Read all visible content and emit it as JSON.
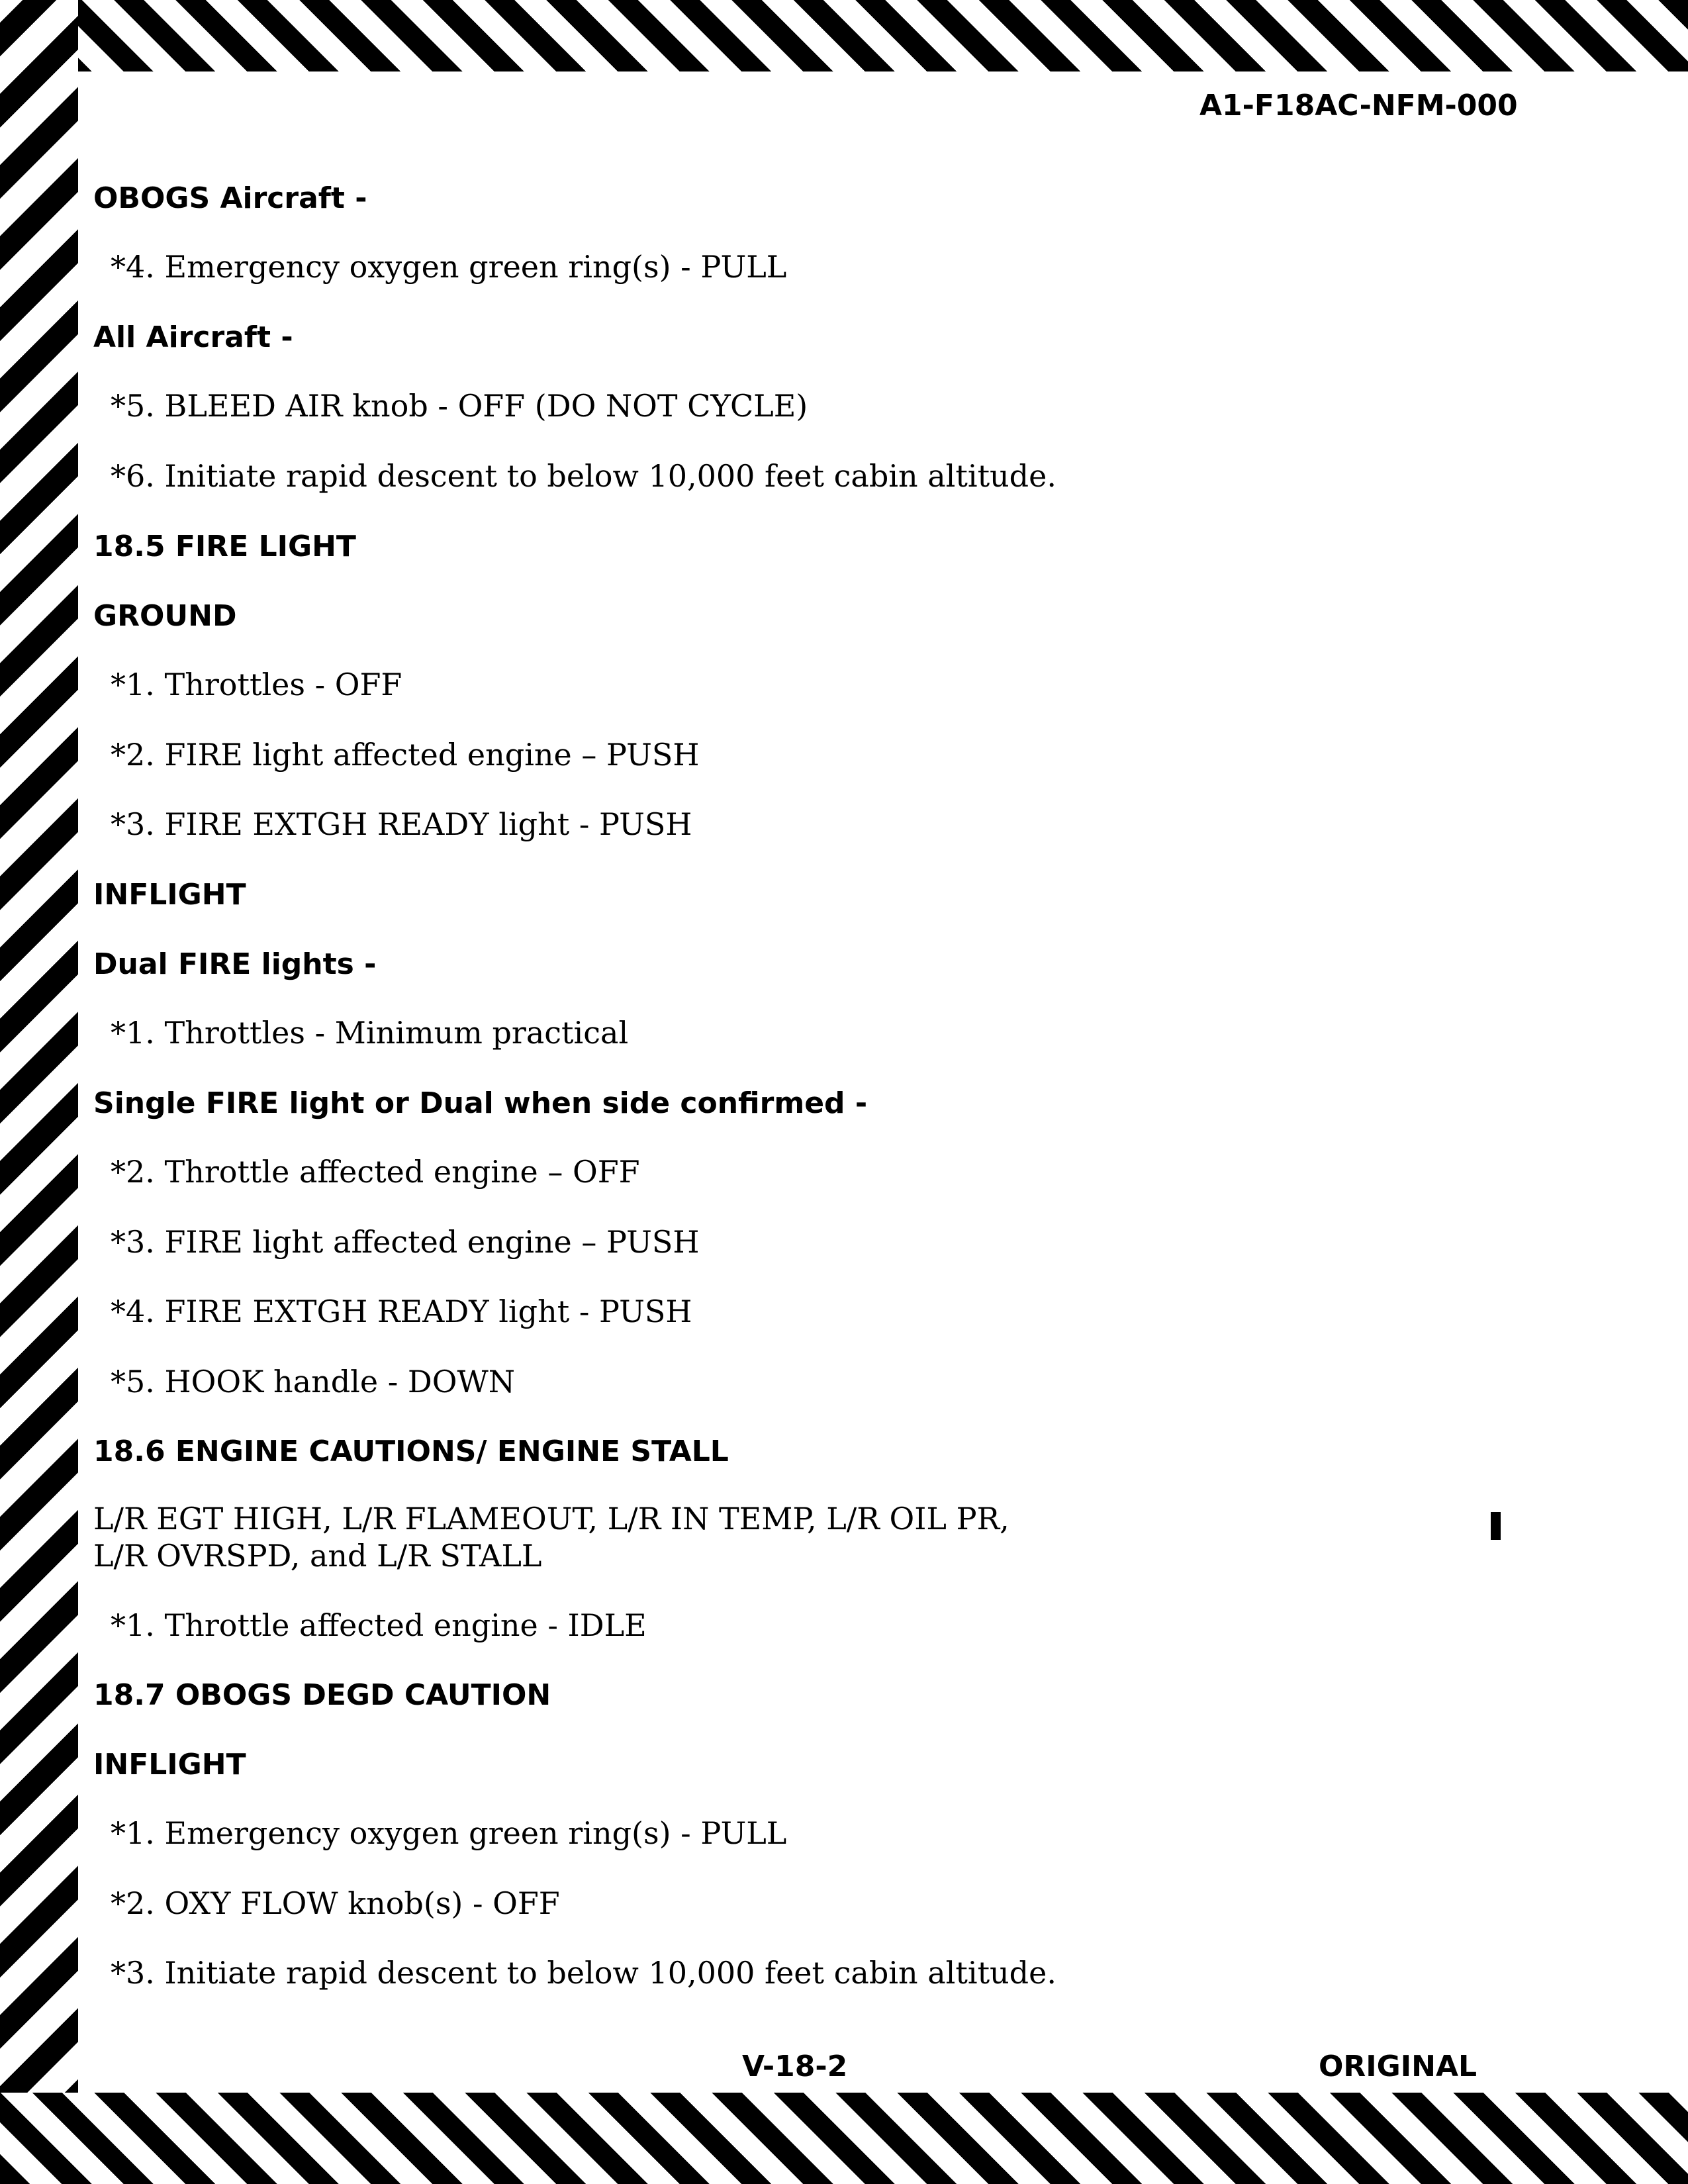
{
  "header": {
    "doc_id": "A1-F18AC-NFM-000"
  },
  "sections": [
    {
      "type": "heading",
      "text": "OBOGS Aircraft -"
    },
    {
      "type": "step",
      "text": "*4.  Emergency oxygen green ring(s) - PULL"
    },
    {
      "type": "heading",
      "text": "All Aircraft -"
    },
    {
      "type": "step",
      "text": "*5.  BLEED AIR knob - OFF (DO NOT CYCLE)"
    },
    {
      "type": "step",
      "text": "*6.  Initiate rapid descent to below 10,000 feet cabin altitude."
    },
    {
      "type": "heading",
      "text": "18.5  FIRE LIGHT"
    },
    {
      "type": "heading",
      "text": "GROUND"
    },
    {
      "type": "step",
      "text": "*1.  Throttles - OFF"
    },
    {
      "type": "step",
      "text": "*2.  FIRE light affected engine – PUSH"
    },
    {
      "type": "step",
      "text": "*3.  FIRE EXTGH READY light - PUSH"
    },
    {
      "type": "heading",
      "text": "INFLIGHT"
    },
    {
      "type": "heading",
      "text": "Dual FIRE lights -"
    },
    {
      "type": "step",
      "text": "*1.  Throttles - Minimum practical"
    },
    {
      "type": "heading",
      "text": "Single FIRE light or Dual when side confirmed -"
    },
    {
      "type": "step",
      "text": "*2.  Throttle affected engine – OFF"
    },
    {
      "type": "step",
      "text": "*3.  FIRE light affected engine – PUSH"
    },
    {
      "type": "step",
      "text": "*4.  FIRE EXTGH READY light - PUSH"
    },
    {
      "type": "step",
      "text": "*5.  HOOK handle - DOWN"
    },
    {
      "type": "heading",
      "text": "18.6  ENGINE CAUTIONS/ ENGINE STALL"
    },
    {
      "type": "paragraph",
      "lines": [
        "L/R EGT HIGH, L/R FLAMEOUT, L/R IN TEMP, L/R OIL PR,",
        "L/R OVRSPD, and L/R STALL"
      ]
    },
    {
      "type": "step",
      "text": "*1.  Throttle affected engine - IDLE"
    },
    {
      "type": "heading",
      "text": "18.7  OBOGS DEGD CAUTION"
    },
    {
      "type": "heading",
      "text": "INFLIGHT"
    },
    {
      "type": "step",
      "text": "*1.  Emergency oxygen green ring(s) - PULL"
    },
    {
      "type": "step",
      "text": "*2.  OXY FLOW knob(s) - OFF"
    },
    {
      "type": "step",
      "text": "*3.  Initiate rapid descent to below 10,000 feet cabin altitude."
    }
  ],
  "footer": {
    "page_number": "V-18-2",
    "status": "ORIGINAL"
  }
}
